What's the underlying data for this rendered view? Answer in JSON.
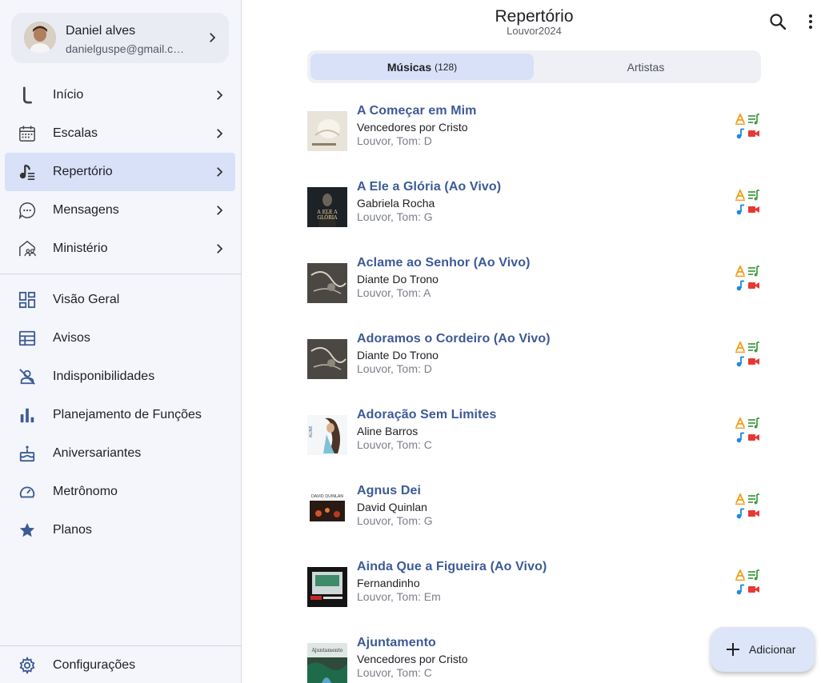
{
  "profile": {
    "name": "Daniel alves",
    "email": "danielguspe@gmail.com"
  },
  "nav_primary": [
    {
      "label": "Início",
      "icon": "guitar-icon",
      "active": false
    },
    {
      "label": "Escalas",
      "icon": "calendar-icon",
      "active": false
    },
    {
      "label": "Repertório",
      "icon": "music-note-icon",
      "active": true
    },
    {
      "label": "Mensagens",
      "icon": "chat-bubble-icon",
      "active": false
    },
    {
      "label": "Ministério",
      "icon": "church-group-icon",
      "active": false
    }
  ],
  "nav_secondary": [
    {
      "label": "Visão Geral",
      "icon": "dashboard-icon"
    },
    {
      "label": "Avisos",
      "icon": "notice-board-icon"
    },
    {
      "label": "Indisponibilidades",
      "icon": "person-off-icon"
    },
    {
      "label": "Planejamento de Funções",
      "icon": "bar-chart-icon"
    },
    {
      "label": "Aniversariantes",
      "icon": "cake-icon"
    },
    {
      "label": "Metrônomo",
      "icon": "speedometer-icon"
    },
    {
      "label": "Planos",
      "icon": "star-icon"
    }
  ],
  "nav_settings": {
    "label": "Configurações",
    "icon": "gear-icon"
  },
  "header": {
    "title": "Repertório",
    "subtitle": "Louvor2024"
  },
  "tabs": {
    "musicas_label": "Músicas",
    "musicas_count": "(128)",
    "artistas_label": "Artistas"
  },
  "songs": [
    {
      "title": "A Começar em Mim",
      "artist": "Vencedores por Cristo",
      "meta": "Louvor, Tom: D"
    },
    {
      "title": "A Ele a Glória (Ao Vivo)",
      "artist": "Gabriela Rocha",
      "meta": "Louvor, Tom: G"
    },
    {
      "title": "Aclame ao Senhor (Ao Vivo)",
      "artist": "Diante Do Trono",
      "meta": "Louvor, Tom: A"
    },
    {
      "title": "Adoramos o Cordeiro (Ao Vivo)",
      "artist": "Diante Do Trono",
      "meta": "Louvor, Tom: D"
    },
    {
      "title": "Adoração Sem Limites",
      "artist": "Aline Barros",
      "meta": "Louvor, Tom: C"
    },
    {
      "title": "Agnus Dei",
      "artist": "David Quinlan",
      "meta": "Louvor, Tom: G"
    },
    {
      "title": "Ainda Que a Figueira (Ao Vivo)",
      "artist": "Fernandinho",
      "meta": "Louvor, Tom: Em"
    },
    {
      "title": "Ajuntamento",
      "artist": "Vencedores por Cristo",
      "meta": "Louvor, Tom: C"
    }
  ],
  "fab": {
    "label": "Adicionar"
  },
  "colors": {
    "accent": "#3d5a96",
    "active_bg": "#d8e1f8",
    "cifra": "#f39c12",
    "letra": "#43a047",
    "audio": "#1e88e5",
    "video": "#e53935"
  }
}
